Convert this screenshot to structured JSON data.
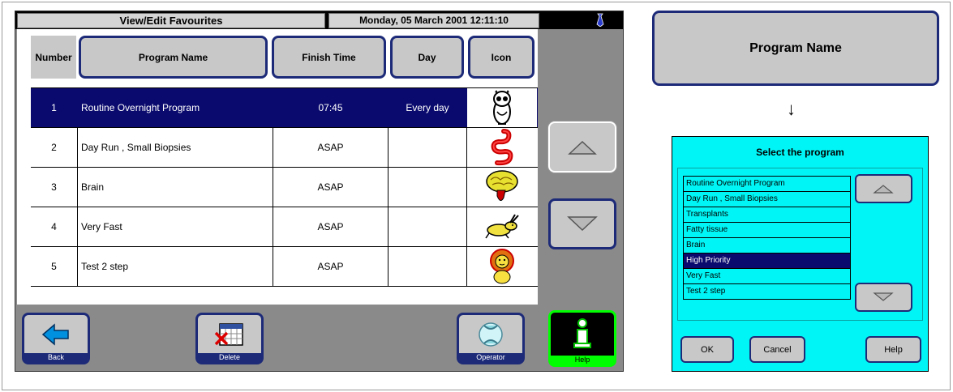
{
  "main_screen": {
    "title": "View/Edit Favourites",
    "datetime": "Monday, 05 March 2001 12:11:10",
    "columns": [
      "Number",
      "Program Name",
      "Finish Time",
      "Day",
      "Icon"
    ],
    "rows": [
      {
        "number": "1",
        "name": "Routine Overnight Program",
        "finish": "07:45",
        "day": "Every day",
        "icon": "owl-icon",
        "selected": true
      },
      {
        "number": "2",
        "name": "Day Run , Small Biopsies",
        "finish": "ASAP",
        "day": "",
        "icon": "intestine-icon",
        "selected": false
      },
      {
        "number": "3",
        "name": "Brain",
        "finish": "ASAP",
        "day": "",
        "icon": "brain-icon",
        "selected": false
      },
      {
        "number": "4",
        "name": "Very Fast",
        "finish": "ASAP",
        "day": "",
        "icon": "hare-icon",
        "selected": false
      },
      {
        "number": "5",
        "name": "Test 2 step",
        "finish": "ASAP",
        "day": "",
        "icon": "lion-icon",
        "selected": false
      }
    ],
    "buttons": {
      "back": "Back",
      "delete": "Delete",
      "operator": "Operator",
      "help": "Help"
    }
  },
  "program_name_button": "Program Name",
  "arrow_symbol": "↓",
  "dialog": {
    "title": "Select the program",
    "items": [
      "Routine Overnight Program",
      "Day Run , Small Biopsies",
      "Transplants",
      "Fatty tissue",
      "Brain",
      "High Priority",
      "Very Fast",
      "Test 2 step"
    ],
    "selected_index": 5,
    "ok": "OK",
    "cancel": "Cancel",
    "help": "Help"
  },
  "colors": {
    "selection": "#0a0a6e",
    "button_border": "#1c2a78",
    "dialog_bg": "#00f6f6",
    "help_accent": "#00ff00"
  }
}
